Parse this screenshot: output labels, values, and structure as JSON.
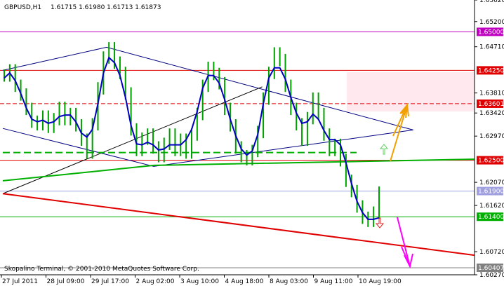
{
  "header": {
    "symbol": "GBPUSD,H1",
    "ohlc": "1.61715 1.61980 1.61713 1.61873"
  },
  "footer": {
    "copyright": "Skopalino Terminal, © 2001-2010 MetaQuotes Software Corp."
  },
  "colors": {
    "candle": "#00a000",
    "ma": "#0000c0",
    "channel": "#000080",
    "support_green": "#00b000",
    "trend_red": "#e00000",
    "arrow_up": "#f0a000",
    "arrow_down": "#ff00ff",
    "zone": "#ffe8ee"
  },
  "chart_data": {
    "type": "line",
    "x_axis_labels": [
      "27 Jul 2011",
      "28 Jul 09:00",
      "29 Jul 17:00",
      "2 Aug 02:00",
      "3 Aug 10:00",
      "4 Aug 18:00",
      "8 Aug 03:00",
      "9 Aug 11:00",
      "10 Aug 19:00"
    ],
    "y_ticks": [
      "1.65620",
      "1.65200",
      "1.64710",
      "1.63810",
      "1.63420",
      "1.62970",
      "1.62070",
      "1.61620",
      "1.60720",
      "1.60270"
    ],
    "ylim": [
      1.6027,
      1.6562
    ],
    "levels": [
      {
        "value": 1.65,
        "label": "1.65000",
        "color": "#c000c0"
      },
      {
        "value": 1.6425,
        "label": "1.64250",
        "color": "#e00000"
      },
      {
        "value": 1.63601,
        "label": "1.63601",
        "color": "#e00000",
        "dashed": true
      },
      {
        "value": 1.625,
        "label": "1.62500",
        "color": "#e00000"
      },
      {
        "value": 1.619,
        "label": "1.61900",
        "color": "#a0a0e0"
      },
      {
        "value": 1.614,
        "label": "1.61400",
        "color": "#00b000"
      },
      {
        "value": 1.60407,
        "label": "1.60407",
        "color": "#808080"
      }
    ],
    "price_series": {
      "name": "",
      "values": [
        1.6415,
        1.6425,
        1.6395,
        1.6378,
        1.635,
        1.6325,
        1.632,
        1.6335,
        1.6315,
        1.633,
        1.6352,
        1.633,
        1.634,
        1.6318,
        1.629,
        1.6265,
        1.632,
        1.639,
        1.645,
        1.6468,
        1.644,
        1.642,
        1.638,
        1.631,
        1.627,
        1.6292,
        1.63,
        1.6275,
        1.6258,
        1.6282,
        1.63,
        1.627,
        1.629,
        1.6265,
        1.63,
        1.634,
        1.6395,
        1.643,
        1.6418,
        1.64,
        1.635,
        1.6318,
        1.6275,
        1.6258,
        1.6252,
        1.6268,
        1.6305,
        1.637,
        1.642,
        1.6458,
        1.6445,
        1.6395,
        1.635,
        1.632,
        1.629,
        1.6332,
        1.637,
        1.634,
        1.63,
        1.627,
        1.628,
        1.625,
        1.621,
        1.619,
        1.616,
        1.6138,
        1.6132,
        1.6148,
        1.6187
      ]
    },
    "moving_average": {
      "name": "",
      "values": [
        1.641,
        1.642,
        1.6405,
        1.638,
        1.6352,
        1.633,
        1.6325,
        1.6328,
        1.6322,
        1.6325,
        1.6335,
        1.6338,
        1.6338,
        1.6325,
        1.6303,
        1.6295,
        1.631,
        1.636,
        1.642,
        1.645,
        1.644,
        1.6415,
        1.6372,
        1.6318,
        1.6282,
        1.628,
        1.6285,
        1.628,
        1.627,
        1.6272,
        1.628,
        1.628,
        1.628,
        1.629,
        1.631,
        1.6345,
        1.639,
        1.6415,
        1.6415,
        1.64,
        1.6368,
        1.633,
        1.6298,
        1.6272,
        1.626,
        1.6268,
        1.63,
        1.636,
        1.641,
        1.643,
        1.643,
        1.6408,
        1.6372,
        1.6342,
        1.6322,
        1.6325,
        1.634,
        1.633,
        1.6308,
        1.629,
        1.629,
        1.628,
        1.6245,
        1.6205,
        1.617,
        1.6148,
        1.6135,
        1.6135,
        1.6138
      ]
    },
    "trendlines": [
      {
        "color": "#000080",
        "points": [
          [
            0,
            1.6425
          ],
          [
            22,
            1.647
          ],
          [
            87,
            1.6309
          ]
        ]
      },
      {
        "color": "#000080",
        "points": [
          [
            0,
            1.6312
          ],
          [
            32,
            1.6238
          ],
          [
            87,
            1.6309
          ]
        ]
      },
      {
        "color": "#000000",
        "points": [
          [
            0,
            1.6185
          ],
          [
            55,
            1.6393
          ]
        ]
      },
      {
        "color": "#00b000",
        "points": [
          [
            0,
            1.621
          ],
          [
            32,
            1.624
          ],
          [
            100,
            1.6252
          ]
        ]
      },
      {
        "color": "#e00000",
        "points": [
          [
            0,
            1.6185
          ],
          [
            100,
            1.6065
          ]
        ]
      },
      {
        "color": "#00b000",
        "points": [
          [
            0,
            1.6265
          ],
          [
            75,
            1.6265
          ]
        ],
        "dashed": true
      }
    ]
  }
}
